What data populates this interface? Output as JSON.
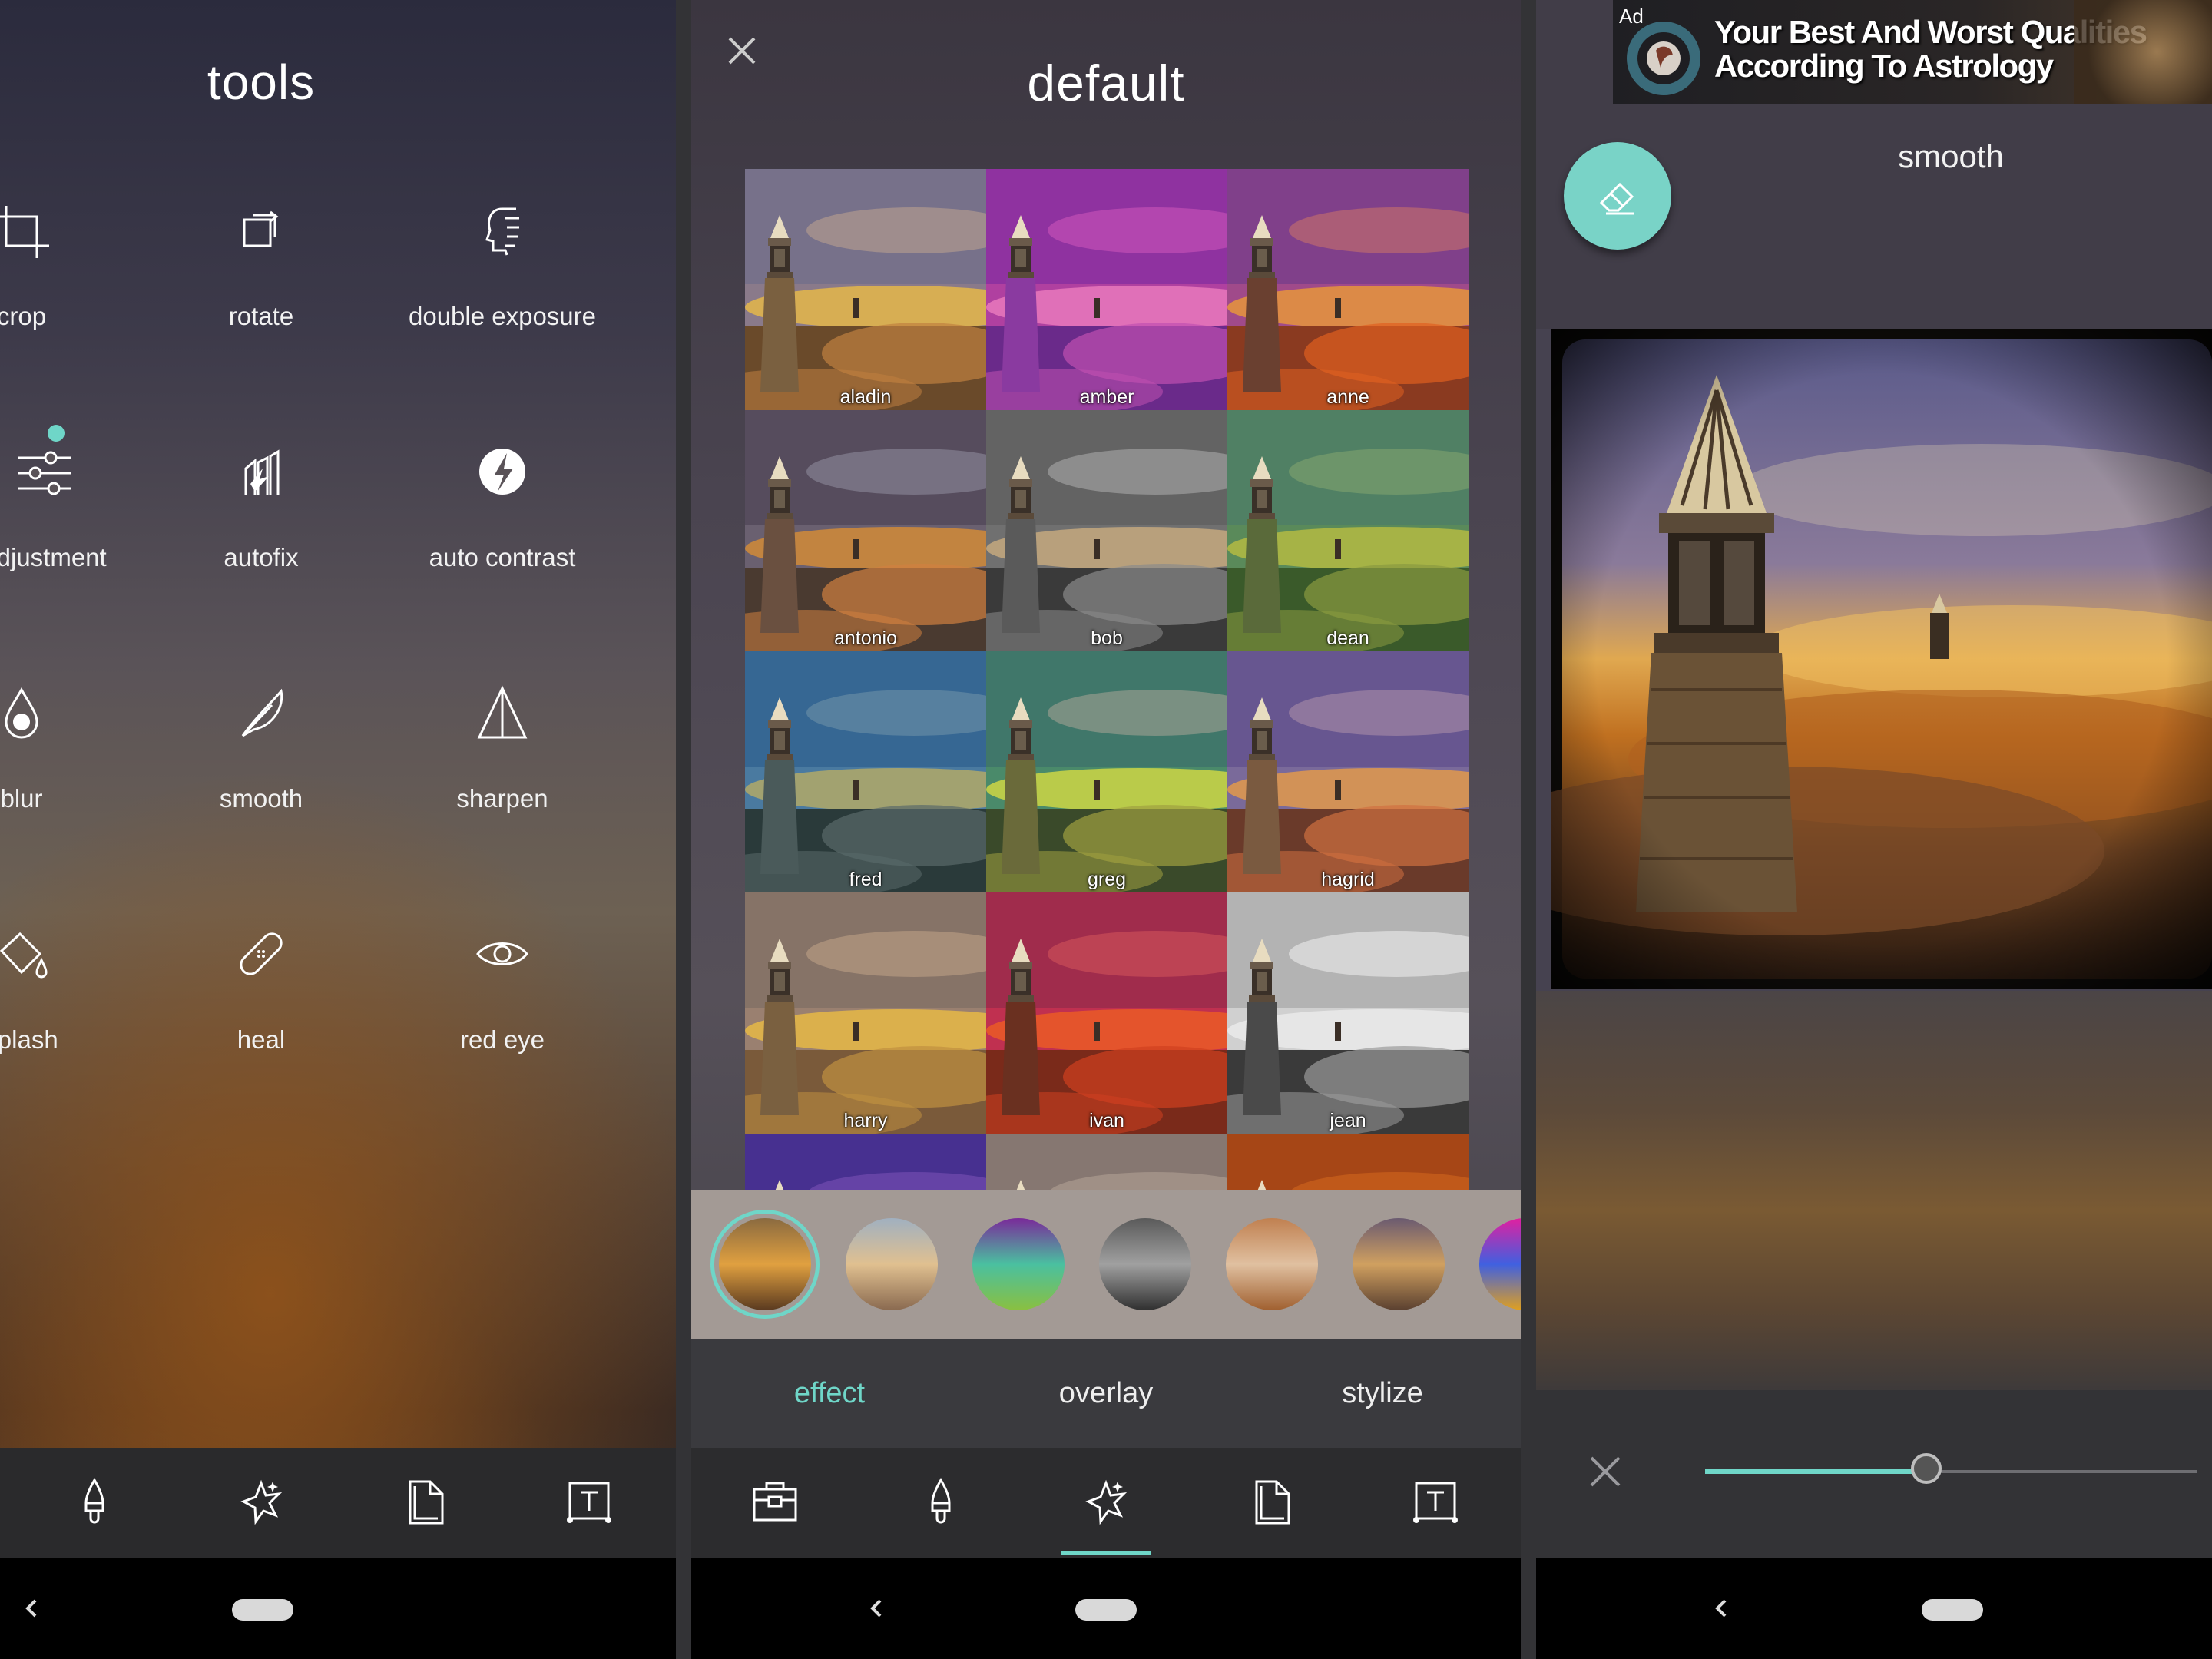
{
  "left_panel": {
    "title": "tools",
    "tools": [
      {
        "label": "crop",
        "icon": "crop-icon"
      },
      {
        "label": "rotate",
        "icon": "rotate-icon"
      },
      {
        "label": "double exposure",
        "icon": "double-exposure-icon"
      },
      {
        "label": "adjustment",
        "icon": "adjustment-sliders-icon",
        "new_badge": true
      },
      {
        "label": "autofix",
        "icon": "autofix-icon"
      },
      {
        "label": "auto contrast",
        "icon": "auto-contrast-icon"
      },
      {
        "label": "blur",
        "icon": "blur-drop-icon"
      },
      {
        "label": "smooth",
        "icon": "feather-icon"
      },
      {
        "label": "sharpen",
        "icon": "triangle-icon"
      },
      {
        "label": "splash",
        "icon": "paint-bucket-icon"
      },
      {
        "label": "heal",
        "icon": "bandage-icon"
      },
      {
        "label": "red eye",
        "icon": "eye-icon"
      }
    ],
    "bottom_icons": [
      "brush-icon",
      "effects-star-icon",
      "stickers-page-icon",
      "text-frame-icon"
    ]
  },
  "middle_panel": {
    "title": "default",
    "filters": [
      "aladin",
      "amber",
      "anne",
      "antonio",
      "bob",
      "dean",
      "fred",
      "greg",
      "hagrid",
      "harry",
      "ivan",
      "jean"
    ],
    "tabs": [
      {
        "label": "effect",
        "active": true
      },
      {
        "label": "overlay",
        "active": false
      },
      {
        "label": "stylize",
        "active": false
      }
    ],
    "category_count": 7,
    "bottom_icons": [
      "camera-bag-icon",
      "brush-icon",
      "effects-star-icon",
      "stickers-page-icon",
      "text-frame-icon"
    ],
    "active_bottom": "effects-star-icon"
  },
  "right_panel": {
    "ad": {
      "tag": "Ad",
      "text_line1": "Your Best And Worst Qualities",
      "text_line2": "According To Astrology"
    },
    "title": "smooth",
    "slider_value": 0.45
  },
  "colors": {
    "accent": "#6fd6c8",
    "fab": "#79d3c7",
    "bar": "#2a2a2c"
  }
}
